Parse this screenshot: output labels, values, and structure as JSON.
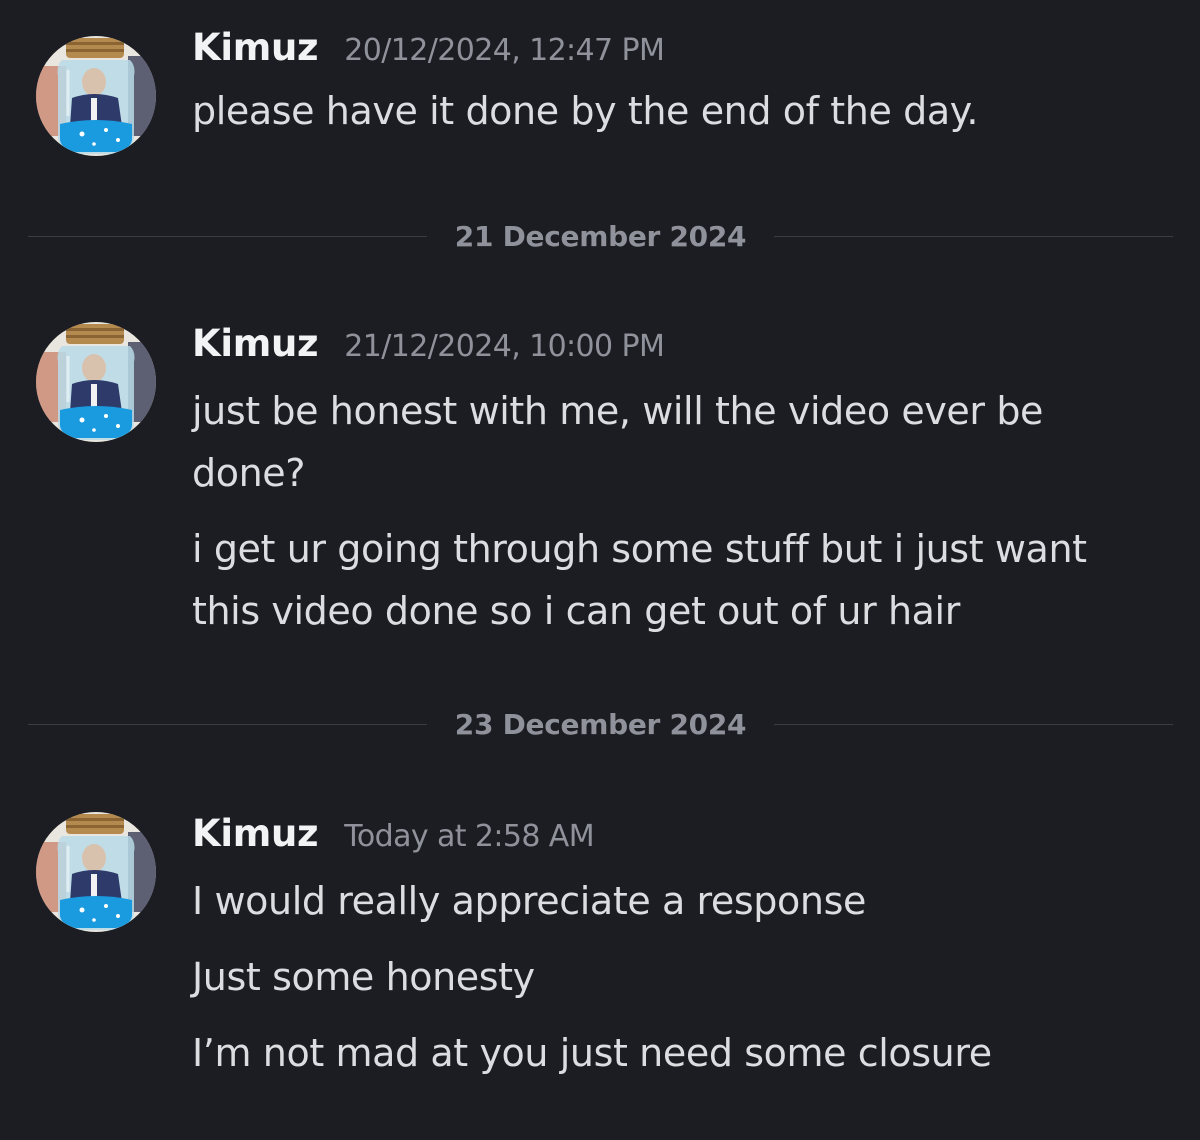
{
  "messages": [
    {
      "username": "Kimuz",
      "timestamp": "20/12/2024, 12:47 PM",
      "lines": [
        "please have it done by the end of the day."
      ]
    },
    {
      "username": "Kimuz",
      "timestamp": "21/12/2024, 10:00 PM",
      "lines": [
        "just be honest with me, will the video ever be done?",
        "i get ur going through some stuff but i just want this video done so i can get out of ur hair"
      ]
    },
    {
      "username": "Kimuz",
      "timestamp": "Today at 2:58 AM",
      "lines": [
        "I would really appreciate a response",
        "Just some honesty",
        "I’m not mad at you just need some closure"
      ]
    }
  ],
  "dividers": [
    "21 December 2024",
    "23 December 2024"
  ],
  "colors": {
    "background": "#1c1d22",
    "username": "#f2f3f5",
    "timestamp": "#8f929b",
    "message": "#dcdde1",
    "divider_line": "#3b3d44"
  }
}
